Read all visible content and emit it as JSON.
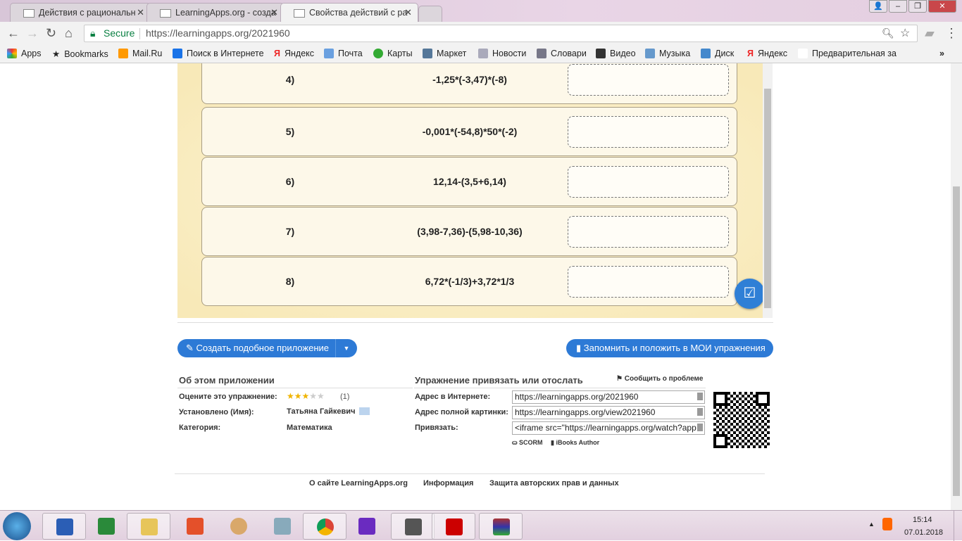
{
  "browser": {
    "tabs": [
      {
        "title": "Действия с рациональн"
      },
      {
        "title": "LearningApps.org - созда"
      },
      {
        "title": "Свойства действий с ра"
      }
    ],
    "secure_label": "Secure",
    "url": "https://learningapps.org/2021960",
    "bookmarks": [
      "Apps",
      "Bookmarks",
      "Mail.Ru",
      "Поиск в Интернете",
      "Яндекс",
      "Почта",
      "Карты",
      "Маркет",
      "Новости",
      "Словари",
      "Видео",
      "Музыка",
      "Диск",
      "Яндекс",
      "Предварительная за"
    ]
  },
  "exercise": {
    "rows": [
      {
        "num": "4)",
        "expr": "-1,25*(-3,47)*(-8)",
        "answer": ""
      },
      {
        "num": "5)",
        "expr": "-0,001*(-54,8)*50*(-2)",
        "answer": ""
      },
      {
        "num": "6)",
        "expr": "12,14-(3,5+6,14)",
        "answer": ""
      },
      {
        "num": "7)",
        "expr": "(3,98-7,36)-(5,98-10,36)",
        "answer": ""
      },
      {
        "num": "8)",
        "expr": "6,72*(-1/3)+3,72*1/3",
        "answer": ""
      }
    ]
  },
  "actions": {
    "create": "Создать подобное приложение",
    "save": "Запомнить и положить в МОИ упражнения"
  },
  "about": {
    "title": "Об этом приложении",
    "rate_label": "Оцените это упражнение:",
    "rating": 3,
    "rating_max": 5,
    "rating_count": "(1)",
    "author_label": "Установлено (Имя):",
    "author": "Татьяна Гайкевич",
    "category_label": "Категория:",
    "category": "Математика"
  },
  "share": {
    "title": "Упражнение привязать или отослать",
    "report": "Сообщить о проблеме",
    "web_label": "Адрес в Интернете:",
    "web": "https://learningapps.org/2021960",
    "full_label": "Адрес полной картинки:",
    "full": "https://learningapps.org/view2021960",
    "embed_label": "Привязать:",
    "embed": "<iframe src=\"https://learningapps.org/watch?app",
    "scorm": "SCORM",
    "ibooks": "iBooks Author"
  },
  "footer": {
    "links": [
      "О сайте LearningApps.org",
      "Информация",
      "Защита авторских прав и данных"
    ]
  },
  "taskbar": {
    "time": "15:14",
    "date": "07.01.2018"
  }
}
